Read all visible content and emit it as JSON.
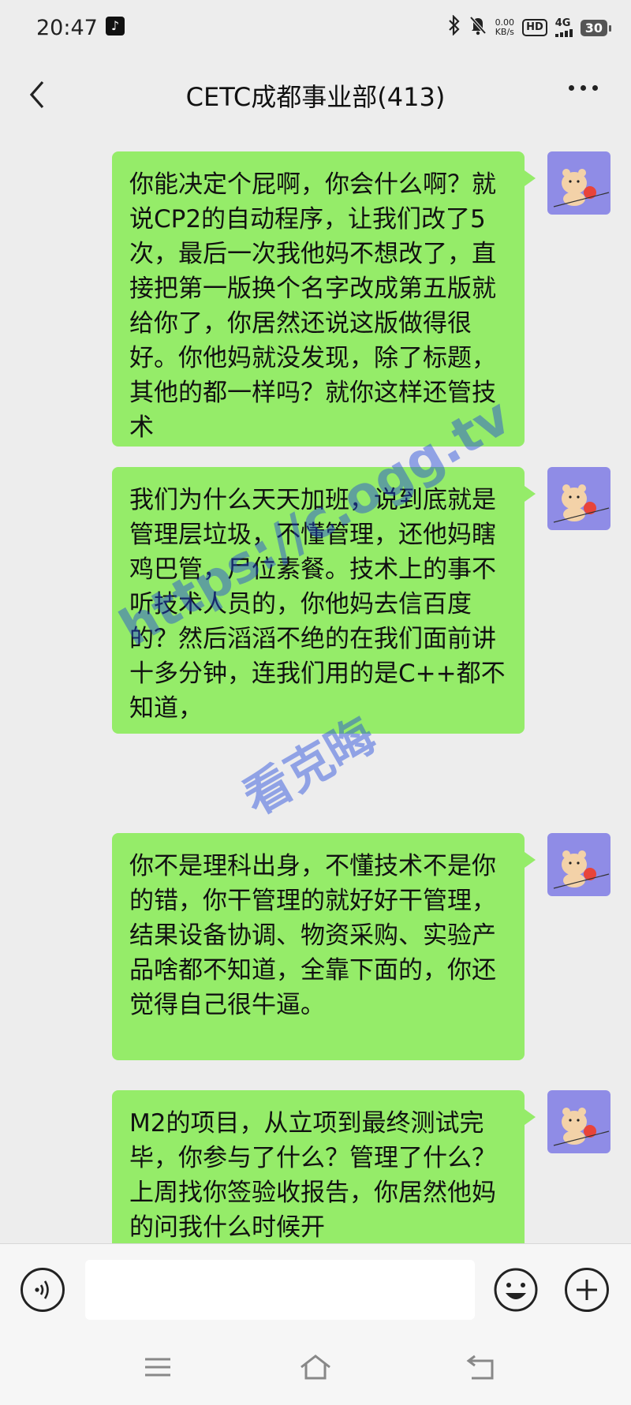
{
  "status_bar": {
    "time": "20:47",
    "app_icon": "tiktok-icon",
    "bluetooth_icon": "bluetooth-icon",
    "mute_icon": "mute-icon",
    "net_speed_value": "0.00",
    "net_speed_unit": "KB/s",
    "hd_label": "HD",
    "network_label": "4G",
    "battery_level": "30"
  },
  "header": {
    "title": "CETC成都事业部(413)",
    "back_icon": "chevron-left-icon",
    "more_icon": "more-dots-icon"
  },
  "messages": [
    {
      "text": "你能决定个屁啊，你会什么啊？就说CP2的自动程序，让我们改了5次，最后一次我他妈不想改了，直接把第一版换个名字改成第五版就给你了，你居然还说这版做得很好。你他妈就没发现，除了标题，其他的都一样吗？就你这样还管技术"
    },
    {
      "text": "我们为什么天天加班，说到底就是管理层垃圾，不懂管理，还他妈瞎鸡巴管，尸位素餐。技术上的事不听技术人员的，你他妈去信百度的？然后滔滔不绝的在我们面前讲十多分钟，连我们用的是C++都不知道，"
    },
    {
      "text": "你不是理科出身，不懂技术不是你的错，你干管理的就好好干管理，结果设备协调、物资采购、实验产品啥都不知道，全靠下面的，你还觉得自己很牛逼。"
    },
    {
      "text": "M2的项目，从立项到最终测试完毕，你参与了什么？管理了什么？上周找你签验收报告，你居然他妈的问我什么时候开"
    }
  ],
  "watermark": {
    "line1": "https://c.ogg.tv",
    "line2": "看克晦"
  },
  "input_bar": {
    "voice_icon": "voice-icon",
    "placeholder": "",
    "emoji_icon": "emoji-icon",
    "plus_icon": "plus-icon"
  },
  "system_nav": {
    "menu_icon": "menu-icon",
    "home_icon": "home-icon",
    "back_icon": "back-icon"
  },
  "colors": {
    "bubble": "#95ec69",
    "background": "#ededed",
    "avatar_bg": "#8f8ce6"
  }
}
